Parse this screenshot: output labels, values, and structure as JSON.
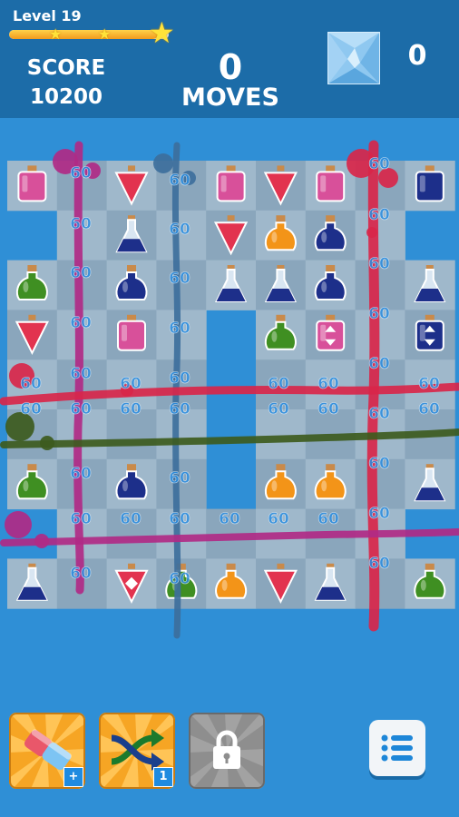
{
  "header": {
    "level_label": "Level 19",
    "level_progress": 0.93,
    "progress_stars": 3,
    "score_label": "SCORE",
    "score_value": "10200",
    "moves_value": "0",
    "moves_label": "MOVES",
    "ice_count": "0"
  },
  "board": {
    "point_popup": "60",
    "rows": [
      [
        "potion-square-pink",
        "empty",
        "potion-triangle-red",
        "empty",
        "potion-square-pink",
        "potion-triangle-red",
        "potion-square-pink",
        "empty",
        "potion-square-navy"
      ],
      [
        "hole",
        "empty",
        "flask-navy",
        "empty",
        "potion-triangle-red",
        "potion-round-orange",
        "potion-round-navy",
        "empty",
        "hole"
      ],
      [
        "potion-round-green",
        "empty",
        "potion-round-navy",
        "empty",
        "flask-navy",
        "flask-navy",
        "potion-round-navy",
        "empty",
        "flask-navy"
      ],
      [
        "potion-triangle-red",
        "empty",
        "potion-square-pink",
        "empty",
        "hole",
        "potion-round-green",
        "potion-square-pink-special",
        "empty",
        "potion-square-navy-special"
      ],
      [
        "empty",
        "empty",
        "empty",
        "empty",
        "hole",
        "empty",
        "empty",
        "empty",
        "empty"
      ],
      [
        "empty",
        "empty",
        "empty",
        "empty",
        "hole",
        "empty",
        "empty",
        "empty",
        "empty"
      ],
      [
        "potion-round-green",
        "empty",
        "potion-round-navy",
        "empty",
        "hole",
        "potion-round-orange",
        "potion-round-orange",
        "empty",
        "flask-navy"
      ],
      [
        "hole",
        "empty",
        "empty",
        "empty",
        "empty",
        "empty",
        "empty",
        "empty",
        "hole"
      ],
      [
        "flask-navy",
        "empty",
        "potion-triangle-red-special",
        "potion-round-green",
        "potion-round-orange",
        "potion-triangle-red",
        "flask-navy",
        "empty",
        "potion-round-green"
      ]
    ]
  },
  "boosters": {
    "eraser_badge": "+",
    "shuffle_badge": "1",
    "locked": "lock"
  },
  "colors": {
    "background": "#2f8fd6",
    "header": "#1c6ca8",
    "splash_red": "#d8264a",
    "splash_green": "#3d5b1e",
    "splash_magenta": "#b02a85",
    "splash_blue": "#3d6f9c",
    "booster_orange": "#f5a623",
    "popup": "#2a8de0"
  }
}
